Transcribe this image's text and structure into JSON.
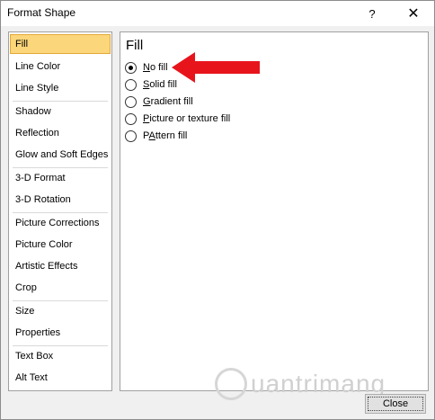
{
  "window": {
    "title": "Format Shape",
    "help_label": "?",
    "close_label": "✕"
  },
  "nav": {
    "items": [
      {
        "label": "Fill",
        "selected": true
      },
      {
        "label": "Line Color"
      },
      {
        "label": "Line Style"
      },
      {
        "label": "Shadow"
      },
      {
        "label": "Reflection"
      },
      {
        "label": "Glow and Soft Edges"
      },
      {
        "label": "3-D Format"
      },
      {
        "label": "3-D Rotation"
      },
      {
        "label": "Picture Corrections"
      },
      {
        "label": "Picture Color"
      },
      {
        "label": "Artistic Effects"
      },
      {
        "label": "Crop"
      },
      {
        "label": "Size"
      },
      {
        "label": "Properties"
      },
      {
        "label": "Text Box"
      },
      {
        "label": "Alt Text"
      }
    ]
  },
  "panel": {
    "title": "Fill",
    "options": [
      {
        "label": "No fill",
        "accel": "N",
        "rest": "o fill",
        "checked": true
      },
      {
        "label": "Solid fill",
        "accel": "S",
        "rest": "olid fill",
        "checked": false
      },
      {
        "label": "Gradient fill",
        "accel": "G",
        "rest": "radient fill",
        "checked": false
      },
      {
        "label": "Picture or texture fill",
        "accel": "P",
        "rest": "icture or texture fill",
        "checked": false
      },
      {
        "label": "Pattern fill",
        "accel": "A",
        "pre": "P",
        "rest": "ttern fill",
        "checked": false
      }
    ]
  },
  "footer": {
    "close_button": "Close"
  },
  "watermark": {
    "text": "uantrimang"
  },
  "colors": {
    "selected_bg": "#fcd67a",
    "arrow": "#e8141c"
  }
}
